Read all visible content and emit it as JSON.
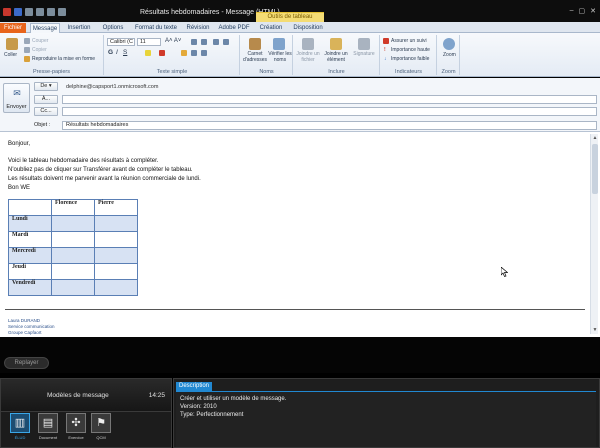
{
  "window": {
    "title": "Résultats hebdomadaires - Message (HTML)",
    "context_tab": "Outils de tableau",
    "controls": [
      "–",
      "▢",
      "✕"
    ]
  },
  "tabs": [
    {
      "label": "Fichier",
      "kind": "file"
    },
    {
      "label": "Message",
      "kind": "active"
    },
    {
      "label": "Insertion",
      "kind": "normal"
    },
    {
      "label": "Options",
      "kind": "normal"
    },
    {
      "label": "Format du texte",
      "kind": "normal"
    },
    {
      "label": "Révision",
      "kind": "normal"
    },
    {
      "label": "Adobe PDF",
      "kind": "normal"
    },
    {
      "label": "Création",
      "kind": "normal"
    },
    {
      "label": "Disposition",
      "kind": "normal"
    }
  ],
  "ribbon": {
    "clipboard": {
      "label": "Presse-papiers",
      "paste": "Coller",
      "cut": "Couper",
      "copy": "Copier",
      "format_painter": "Reproduire la mise en forme"
    },
    "basic_text": {
      "label": "Texte simple",
      "font": "Calibri (C",
      "size": "11"
    },
    "names": {
      "label": "Noms",
      "address_book": "Carnet d'adresses",
      "check_names": "Vérifier les noms"
    },
    "include": {
      "label": "Inclure",
      "attach_file": "Joindre un fichier",
      "attach_item": "Joindre un élément",
      "signature": "Signature"
    },
    "tags": {
      "label": "Indicateurs",
      "follow_up": "Assurer un suivi",
      "high": "Importance haute",
      "low": "Importance faible"
    },
    "zoom": {
      "label": "Zoom",
      "zoom": "Zoom"
    }
  },
  "header": {
    "send": "Envoyer",
    "from_btn": "De ▾",
    "from_value": "delphine@capsport1.onmicrosoft.com",
    "to_btn": "À...",
    "cc_btn": "Cc...",
    "subject_label": "Objet :",
    "subject_value": "Résultats hebdomadaires",
    "to_value": "",
    "cc_value": ""
  },
  "body": {
    "greeting": "Bonjour,",
    "line1": "Voici le tableau hebdomadaire des résultats à compléter.",
    "line2": "N'oubliez pas de cliquer sur Transférer avant de compléter le tableau.",
    "line3": "Les résultats doivent me parvenir avant la réunion commerciale de lundi.",
    "line4": "Bon WE",
    "table": {
      "headers": [
        "",
        "Florence",
        "Pierre"
      ],
      "rows": [
        "Lundi",
        "Mardi",
        "Mercredi",
        "Jeudi",
        "Vendredi"
      ]
    },
    "signature": [
      "Laura DURAND",
      "Service communication",
      "Groupe Capfaort"
    ]
  },
  "player": {
    "pill": "Replayer",
    "panel_title": "Modèles de message",
    "time": "14:25",
    "buttons": [
      {
        "label": "ÉLUD",
        "icon": "film-icon",
        "glyph": "▥",
        "active": true
      },
      {
        "label": "Document",
        "icon": "document-icon",
        "glyph": "▤",
        "active": false
      },
      {
        "label": "Exercice",
        "icon": "puzzle-icon",
        "glyph": "✣",
        "active": false
      },
      {
        "label": "QCM",
        "icon": "quiz-icon",
        "glyph": "⚑",
        "active": false
      }
    ],
    "description": {
      "tab": "Description",
      "line1": "Créer et utiliser un modèle de message.",
      "line2": "Version: 2010",
      "line3": "Type: Perfectionnement"
    }
  },
  "colors": {
    "file_tab": "#e8641b",
    "accent": "#2188d1",
    "table_border": "#5a7fb5",
    "table_highlight": "#d7e2f3"
  }
}
